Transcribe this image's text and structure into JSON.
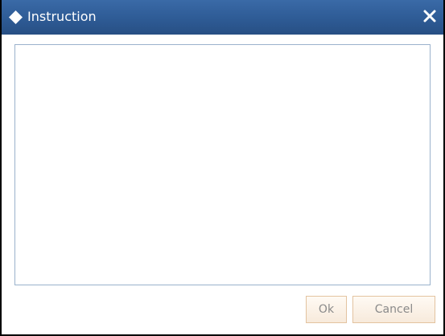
{
  "dialog": {
    "title": "Instruction",
    "title_icon": "diamond-icon",
    "close_icon": "close-icon",
    "content_text": "",
    "buttons": {
      "ok_label": "Ok",
      "cancel_label": "Cancel"
    }
  },
  "colors": {
    "titlebar": "#2e5b95",
    "content_border": "#9ab2cc",
    "button_border": "#e3c3a0",
    "button_text": "#8a8a8a"
  }
}
